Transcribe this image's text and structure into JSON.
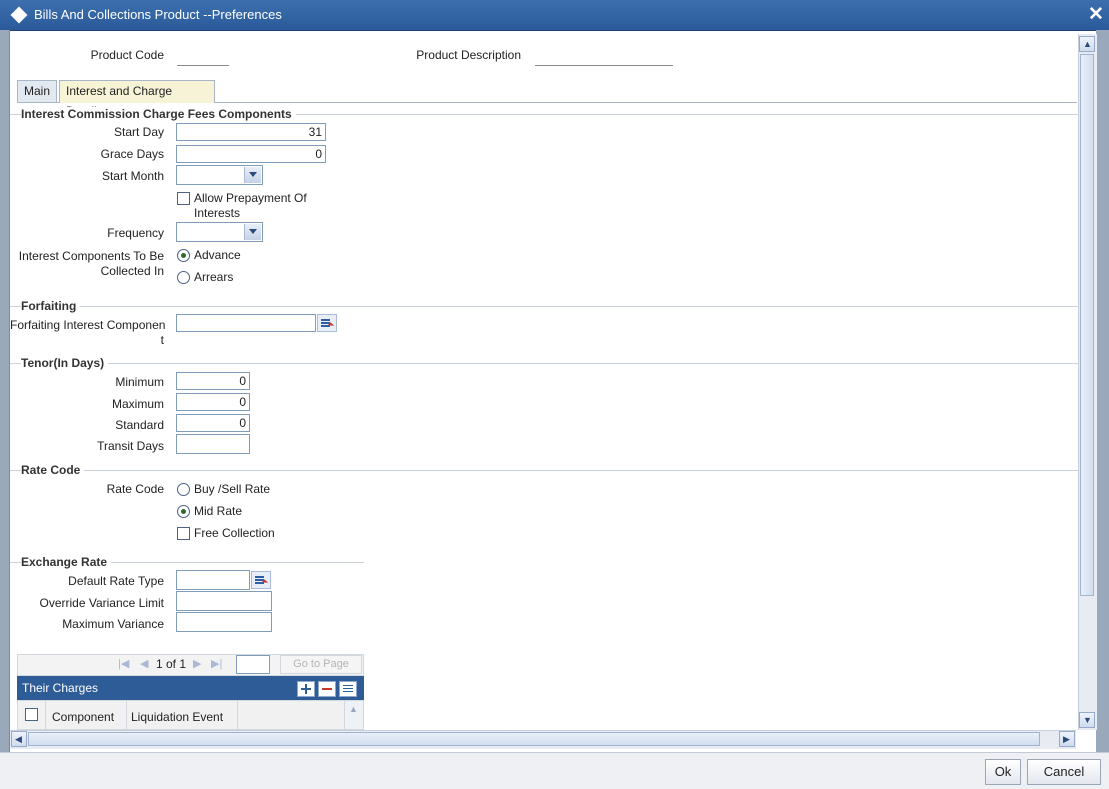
{
  "window": {
    "title": "Bills And Collections Product --Preferences",
    "close_glyph": "✕"
  },
  "header": {
    "product_code_label": "Product Code",
    "product_description_label": "Product Description"
  },
  "tabs": [
    {
      "label": "Main"
    },
    {
      "label": "Interest and Charge Details"
    }
  ],
  "interest_section": {
    "heading": "Interest Commission Charge Fees Components",
    "start_day_label": "Start Day",
    "start_day_value": "31",
    "grace_days_label": "Grace Days",
    "grace_days_value": "0",
    "start_month_label": "Start Month",
    "allow_prepayment_label_1": "Allow Prepayment Of",
    "allow_prepayment_label_2": "Interests",
    "frequency_label": "Frequency",
    "collected_in_label_1": "Interest Components To Be",
    "collected_in_label_2": "Collected In",
    "advance_label": "Advance",
    "arrears_label": "Arrears"
  },
  "forfaiting_section": {
    "heading": "Forfaiting",
    "component_label_1": "Forfaiting Interest Componen",
    "component_label_2": "t"
  },
  "tenor_section": {
    "heading": "Tenor(In Days)",
    "minimum_label": "Minimum",
    "minimum_value": "0",
    "maximum_label": "Maximum",
    "maximum_value": "0",
    "standard_label": "Standard",
    "standard_value": "0",
    "transit_label": "Transit Days"
  },
  "rate_code_section": {
    "heading": "Rate Code",
    "rate_code_label": "Rate Code",
    "buy_sell_label": "Buy /Sell Rate",
    "mid_rate_label": "Mid Rate",
    "free_collection_label": "Free Collection"
  },
  "exchange_rate_section": {
    "heading": "Exchange Rate",
    "default_rate_type_label": "Default Rate Type",
    "override_variance_label": "Override Variance Limit",
    "maximum_variance_label": "Maximum Variance"
  },
  "their_charges": {
    "pager_text": "1 of 1",
    "goto_label": "Go to Page",
    "title": "Their Charges",
    "columns": [
      "Component",
      "Liquidation Event"
    ]
  },
  "footer": {
    "ok_label": "Ok",
    "cancel_label": "Cancel"
  },
  "colors": {
    "titlebar": "#2a5a9a",
    "grid_header": "#2e5c97",
    "active_tab": "#f7f3d6"
  }
}
